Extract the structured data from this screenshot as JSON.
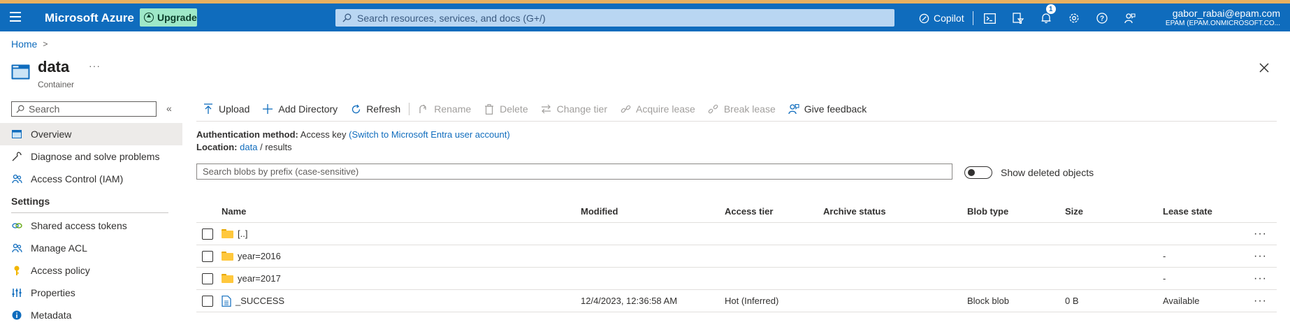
{
  "colors": {
    "topbar": "#0f6cbd",
    "accent_strip": "#e8b060",
    "upgrade_bg": "#9ee8c8",
    "link": "#0f6cbd"
  },
  "topbar": {
    "brand": "Microsoft Azure",
    "upgrade_label": "Upgrade",
    "search_placeholder": "Search resources, services, and docs (G+/)",
    "copilot_label": "Copilot",
    "notification_count": "1",
    "account_user": "gabor_rabai@epam.com",
    "account_tenant": "EPAM (EPAM.ONMICROSOFT.CO..."
  },
  "breadcrumb": {
    "home": "Home"
  },
  "resource": {
    "title": "data",
    "more": "···",
    "type": "Container"
  },
  "sidebar": {
    "search_placeholder": "Search",
    "collapse": "«",
    "top_items": [
      {
        "label": "Overview",
        "icon": "overview-icon"
      },
      {
        "label": "Diagnose and solve problems",
        "icon": "wrench-icon"
      },
      {
        "label": "Access Control (IAM)",
        "icon": "people-icon"
      }
    ],
    "settings_heading": "Settings",
    "settings_items": [
      {
        "label": "Shared access tokens",
        "icon": "link-icon"
      },
      {
        "label": "Manage ACL",
        "icon": "people-icon"
      },
      {
        "label": "Access policy",
        "icon": "key-icon"
      },
      {
        "label": "Properties",
        "icon": "properties-icon"
      },
      {
        "label": "Metadata",
        "icon": "info-icon"
      }
    ]
  },
  "toolbar": {
    "upload": "Upload",
    "add_directory": "Add Directory",
    "refresh": "Refresh",
    "rename": "Rename",
    "delete": "Delete",
    "change_tier": "Change tier",
    "acquire_lease": "Acquire lease",
    "break_lease": "Break lease",
    "give_feedback": "Give feedback"
  },
  "auth": {
    "label": "Authentication method:",
    "value": "Access key",
    "switch_link": "(Switch to Microsoft Entra user account)"
  },
  "location": {
    "label": "Location:",
    "container": "data",
    "separator": "/",
    "folder": "results"
  },
  "blob_search_placeholder": "Search blobs by prefix (case-sensitive)",
  "show_deleted_label": "Show deleted objects",
  "table": {
    "columns": [
      "Name",
      "Modified",
      "Access tier",
      "Archive status",
      "Blob type",
      "Size",
      "Lease state"
    ],
    "rows": [
      {
        "kind": "folder",
        "name": "[..]",
        "modified": "",
        "tier": "",
        "archive": "",
        "blob_type": "",
        "size": "",
        "lease": ""
      },
      {
        "kind": "folder",
        "name": "year=2016",
        "modified": "",
        "tier": "",
        "archive": "",
        "blob_type": "",
        "size": "",
        "lease": "-"
      },
      {
        "kind": "folder",
        "name": "year=2017",
        "modified": "",
        "tier": "",
        "archive": "",
        "blob_type": "",
        "size": "",
        "lease": "-"
      },
      {
        "kind": "file",
        "name": "_SUCCESS",
        "modified": "12/4/2023, 12:36:58 AM",
        "tier": "Hot (Inferred)",
        "archive": "",
        "blob_type": "Block blob",
        "size": "0 B",
        "lease": "Available"
      }
    ],
    "row_more": "···"
  }
}
